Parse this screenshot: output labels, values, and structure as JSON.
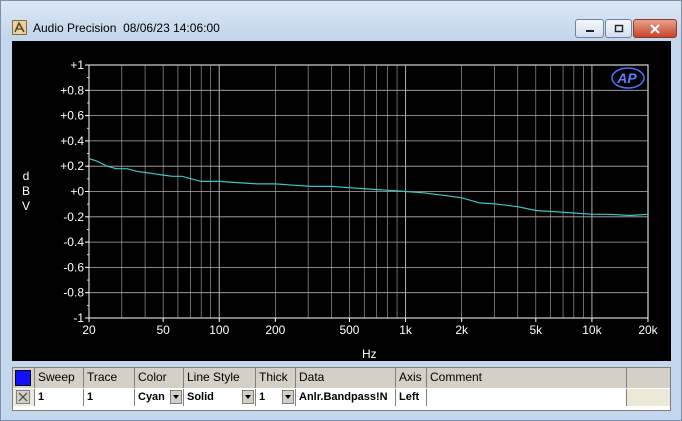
{
  "window": {
    "title": "Audio Precision",
    "datetime": "08/06/23 14:06:00"
  },
  "plot": {
    "y_unit": [
      "d",
      "B",
      "V"
    ],
    "x_unit": "Hz",
    "logo": "AP"
  },
  "chart_data": {
    "type": "line",
    "xlabel": "Hz",
    "ylabel": "dBV",
    "xscale": "log",
    "xlim": [
      20,
      20000
    ],
    "ylim": [
      -1,
      1
    ],
    "x_ticks": [
      "20",
      "50",
      "100",
      "200",
      "500",
      "1k",
      "2k",
      "5k",
      "10k",
      "20k"
    ],
    "x_tick_values": [
      20,
      50,
      100,
      200,
      500,
      1000,
      2000,
      5000,
      10000,
      20000
    ],
    "y_ticks": [
      "+1",
      "+0.8",
      "+0.6",
      "+0.4",
      "+0.2",
      "+0",
      "-0.2",
      "-0.4",
      "-0.6",
      "-0.8",
      "-1"
    ],
    "y_tick_values": [
      1,
      0.8,
      0.6,
      0.4,
      0.2,
      0,
      -0.2,
      -0.4,
      -0.6,
      -0.8,
      -1
    ],
    "grid": true,
    "series": [
      {
        "color": "#38c8c8",
        "x": [
          20,
          22,
          25,
          28,
          32,
          36,
          40,
          45,
          50,
          56,
          63,
          71,
          80,
          90,
          100,
          125,
          160,
          200,
          250,
          315,
          400,
          500,
          630,
          800,
          1000,
          1250,
          1600,
          2000,
          2500,
          3150,
          4000,
          5000,
          6300,
          8000,
          10000,
          12500,
          16000,
          20000
        ],
        "y": [
          0.26,
          0.24,
          0.2,
          0.18,
          0.18,
          0.16,
          0.15,
          0.14,
          0.13,
          0.12,
          0.12,
          0.1,
          0.08,
          0.08,
          0.08,
          0.07,
          0.06,
          0.06,
          0.05,
          0.04,
          0.04,
          0.03,
          0.02,
          0.01,
          0.0,
          -0.01,
          -0.03,
          -0.05,
          -0.09,
          -0.1,
          -0.12,
          -0.15,
          -0.16,
          -0.17,
          -0.18,
          -0.18,
          -0.19,
          -0.18
        ]
      }
    ]
  },
  "table": {
    "headers": [
      "Sweep",
      "Trace",
      "Color",
      "Line Style",
      "Thick",
      "Data",
      "Axis",
      "Comment"
    ],
    "row": {
      "sweep": "1",
      "trace": "1",
      "color": "Cyan",
      "line_style": "Solid",
      "thick": "1",
      "data": "Anlr.Bandpass!N",
      "axis": "Left",
      "comment": ""
    }
  }
}
